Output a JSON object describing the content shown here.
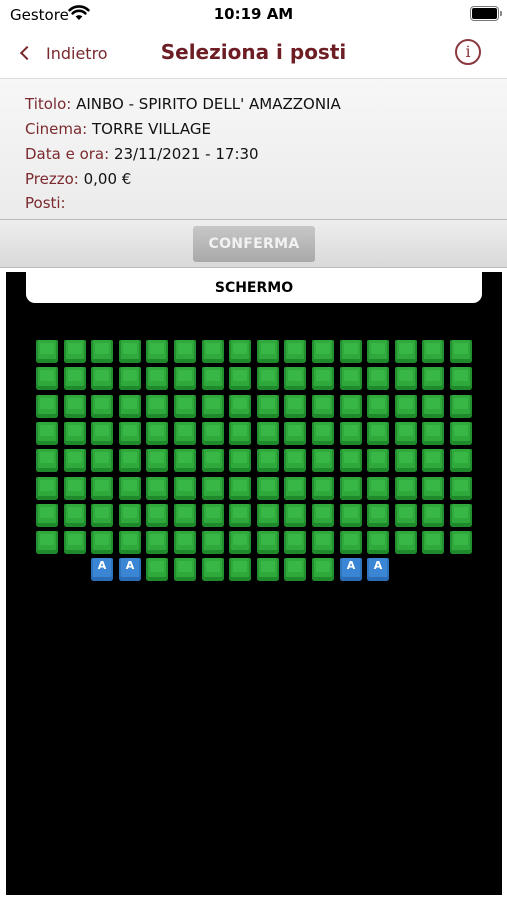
{
  "status_bar": {
    "carrier": "Gestore",
    "time": "10:19 AM"
  },
  "nav": {
    "back_label": "Indietro",
    "title": "Seleziona i posti",
    "info_glyph": "i"
  },
  "details": {
    "title_key": "Titolo:",
    "title_value": "AINBO - SPIRITO DELL' AMAZZONIA",
    "cinema_key": "Cinema:",
    "cinema_value": "TORRE VILLAGE",
    "datetime_key": "Data e ora:",
    "datetime_value": "23/11/2021 - 17:30",
    "price_key": "Prezzo:",
    "price_value": "0,00 €",
    "seats_key": "Posti:",
    "seats_value": ""
  },
  "confirm_label": "CONFERMA",
  "seat_map": {
    "screen_label": "SCHERMO",
    "accessible_glyph": "A",
    "grid_rows": 8,
    "grid_cols": 16,
    "last_row": [
      {
        "type": "accessible"
      },
      {
        "type": "accessible"
      },
      {
        "type": "free"
      },
      {
        "type": "free"
      },
      {
        "type": "free"
      },
      {
        "type": "free"
      },
      {
        "type": "free"
      },
      {
        "type": "free"
      },
      {
        "type": "free"
      },
      {
        "type": "accessible"
      },
      {
        "type": "accessible"
      }
    ]
  },
  "colors": {
    "accent": "#6d1d24",
    "seat_free": "#2fa83c",
    "seat_accessible": "#3b86d4",
    "map_background": "#000000"
  },
  "icons": [
    "wifi-icon",
    "battery-icon",
    "chevron-left-icon",
    "info-icon"
  ]
}
